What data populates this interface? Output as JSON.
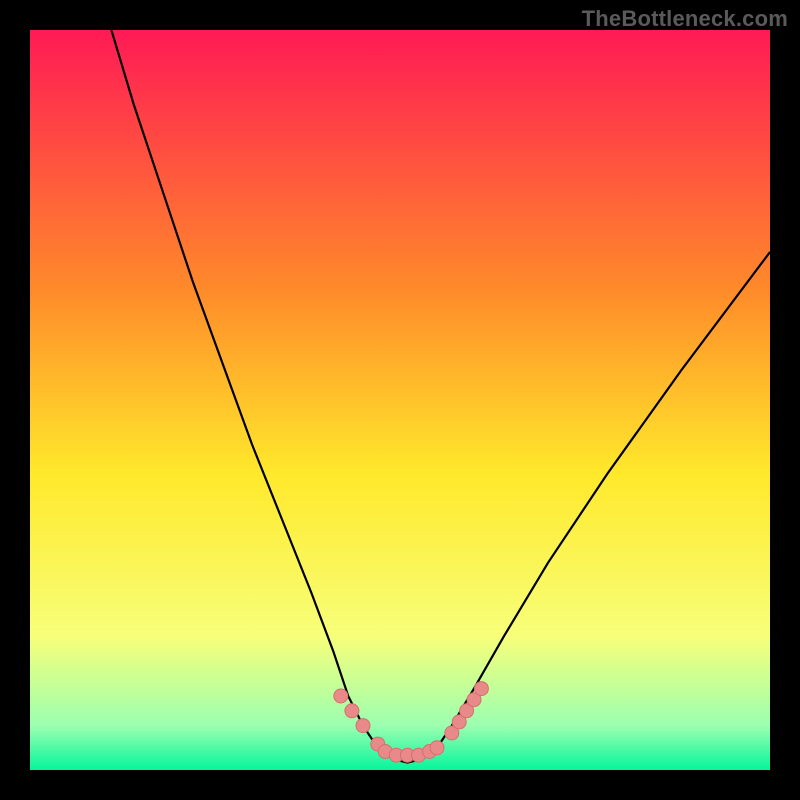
{
  "watermark": "TheBottleneck.com",
  "colors": {
    "frame": "#000000",
    "curve": "#000000",
    "markers": "#e78a89",
    "markers_stroke": "#d76f6e",
    "grad_top": "#ff1a55",
    "grad_mid1": "#ff8a2a",
    "grad_mid2": "#ffe92b",
    "grad_low1": "#f7ff7a",
    "grad_low2": "#9cffb0",
    "grad_bottom": "#06f59c"
  },
  "chart_data": {
    "type": "line",
    "title": "",
    "xlabel": "",
    "ylabel": "",
    "xlim": [
      0,
      100
    ],
    "ylim": [
      0,
      100
    ],
    "series": [
      {
        "name": "bottleneck-curve",
        "x": [
          11,
          14,
          18,
          22,
          26,
          30,
          34,
          38,
          41,
          43,
          45,
          47,
          49,
          51,
          53,
          55,
          57,
          60,
          64,
          70,
          78,
          88,
          100
        ],
        "y": [
          100,
          90,
          78,
          66,
          55,
          44,
          34,
          24,
          16,
          10,
          6,
          3,
          1.5,
          1,
          1.5,
          3,
          6,
          11,
          18,
          28,
          40,
          54,
          70
        ]
      }
    ],
    "markers": {
      "name": "highlight-points",
      "points": [
        {
          "x": 42,
          "y": 10
        },
        {
          "x": 43.5,
          "y": 8
        },
        {
          "x": 45,
          "y": 6
        },
        {
          "x": 47,
          "y": 3.5
        },
        {
          "x": 48,
          "y": 2.5
        },
        {
          "x": 49.5,
          "y": 2
        },
        {
          "x": 51,
          "y": 2
        },
        {
          "x": 52.5,
          "y": 2
        },
        {
          "x": 54,
          "y": 2.5
        },
        {
          "x": 55,
          "y": 3
        },
        {
          "x": 57,
          "y": 5
        },
        {
          "x": 58,
          "y": 6.5
        },
        {
          "x": 59,
          "y": 8
        },
        {
          "x": 60,
          "y": 9.5
        },
        {
          "x": 61,
          "y": 11
        }
      ]
    }
  }
}
